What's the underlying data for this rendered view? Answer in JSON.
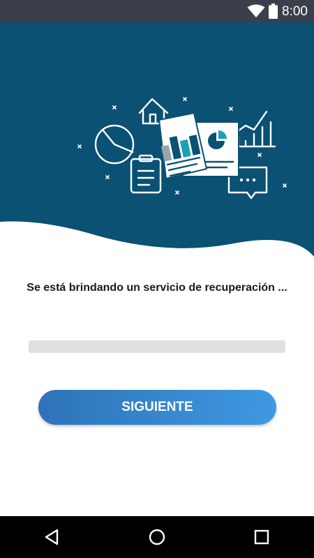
{
  "status_bar": {
    "time": "8:00",
    "icons": [
      "wifi-icon",
      "battery-icon"
    ]
  },
  "hero": {
    "illustration": "business-reports-illustration",
    "background_color": "#0a5173",
    "line_color": "#ffffff",
    "accent_color": "#19a2b5"
  },
  "main": {
    "message": "Se está brindando un servicio de recuperación  ...",
    "progress": 0,
    "next_button_label": "SIGUIENTE"
  },
  "nav_bar": {
    "buttons": [
      "back-icon",
      "home-icon",
      "recents-icon"
    ]
  }
}
